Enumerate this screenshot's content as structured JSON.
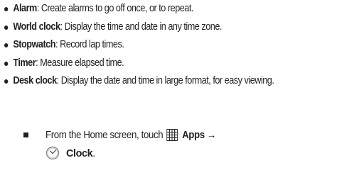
{
  "features": [
    {
      "term": "Alarm",
      "desc": ": Create alarms to go off once, or to repeat."
    },
    {
      "term": "World clock",
      "desc": ": Display the time and date in any time zone."
    },
    {
      "term": "Stopwatch",
      "desc": ": Record lap times."
    },
    {
      "term": "Timer",
      "desc": ": Measure elapsed time."
    },
    {
      "term": "Desk clock",
      "desc": ": Display the date and time in large format, for easy viewing."
    }
  ],
  "step": {
    "prefix": "From the Home screen, touch",
    "apps_label": "Apps",
    "arrow": "→",
    "clock_label": "Clock",
    "end": "."
  },
  "icons": {
    "apps": "apps-grid-icon",
    "clock": "clock-icon"
  },
  "colors": {
    "text": "#231f20"
  }
}
